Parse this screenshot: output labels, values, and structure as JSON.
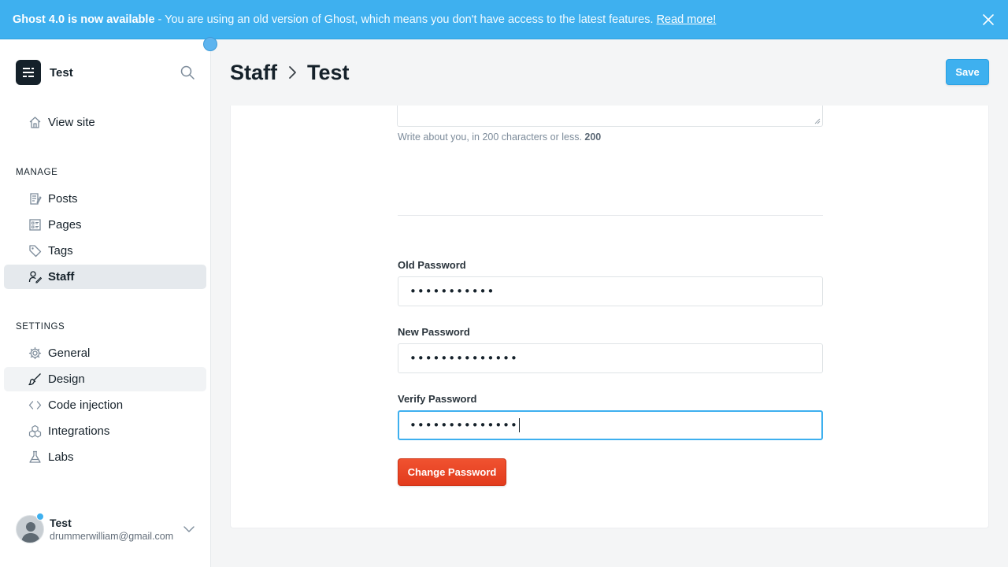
{
  "banner": {
    "title": "Ghost 4.0 is now available",
    "text": "- You are using an old version of Ghost, which means you don't have access to the latest features.",
    "link": "Read more!",
    "bg_color": "#3eb0ef"
  },
  "sidebar": {
    "brand": "Test",
    "top_items": [
      {
        "label": "View site",
        "icon": "home-icon"
      }
    ],
    "manage_label": "MANAGE",
    "manage_items": [
      {
        "label": "Posts",
        "icon": "posts-icon"
      },
      {
        "label": "Pages",
        "icon": "pages-icon"
      },
      {
        "label": "Tags",
        "icon": "tag-icon"
      },
      {
        "label": "Staff",
        "icon": "staff-icon",
        "active": true
      }
    ],
    "settings_label": "SETTINGS",
    "settings_items": [
      {
        "label": "General",
        "icon": "gear-icon"
      },
      {
        "label": "Design",
        "icon": "brush-icon"
      },
      {
        "label": "Code injection",
        "icon": "code-icon"
      },
      {
        "label": "Integrations",
        "icon": "integrations-icon"
      },
      {
        "label": "Labs",
        "icon": "flask-icon"
      }
    ],
    "user": {
      "name": "Test",
      "email": "drummerwilliam@gmail.com"
    }
  },
  "header": {
    "crumb_parent": "Staff",
    "crumb_current": "Test",
    "save_label": "Save"
  },
  "form": {
    "bio_hint": "Write about you, in 200 characters or less.",
    "bio_count": "200",
    "old_password_label": "Old Password",
    "old_password_value": "•••••••••••",
    "new_password_label": "New Password",
    "new_password_value": "••••••••••••••",
    "verify_password_label": "Verify Password",
    "verify_password_value": "••••••••••••••",
    "change_button": "Change Password"
  },
  "colors": {
    "accent": "#3eb0ef",
    "danger": "#e23b1c"
  }
}
